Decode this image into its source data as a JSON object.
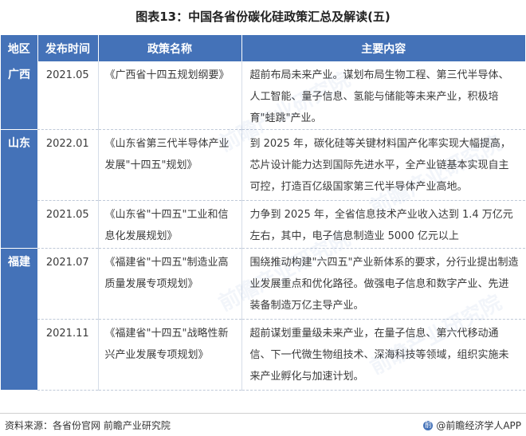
{
  "title": "图表13：中国各省份碳化硅政策汇总及解读(五)",
  "table": {
    "headers": [
      "地区",
      "发布时间",
      "政策名称",
      "主要内容"
    ],
    "regions": [
      {
        "name": "广西",
        "rows": [
          {
            "date": "2021.05",
            "policy": "《广西省十四五规划纲要》",
            "content": "超前布局未来产业。谋划布局生物工程、第三代半导体、人工智能、量子信息、氢能与储能等未来产业，积极培育\"蛙跳\"产业。"
          }
        ]
      },
      {
        "name": "山东",
        "rows": [
          {
            "date": "2022.01",
            "policy": "《山东省第三代半导体产业发展\"十四五\"规划》",
            "content": "到 2025 年，碳化硅等关键材料国产化率实现大幅提高，芯片设计能力达到国际先进水平，全产业链基本实现自主可控，打造百亿级国家第三代半导体产业高地。"
          },
          {
            "date": "2021.05",
            "policy": "《山东省\"十四五\"工业和信息化发展规划》",
            "content": "力争到  2025 年，全省信息技术产业收入达到  1.4  万亿元左右，其中，电子信息制造业 5000 亿元以上"
          }
        ]
      },
      {
        "name": "福建",
        "rows": [
          {
            "date": "2021.07",
            "policy": "《福建省\"十四五\"制造业高质量发展专项规划》",
            "content": "围绕推动构建\"六四五\"产业新体系的要求，分行业提出制造业发展重点和优化路径。做强电子信息和数字产业、先进装备制造万亿主导产业。"
          },
          {
            "date": "2021.11",
            "policy": "《福建省\"十四五\"战略性新兴产业发展专项规划》",
            "content": "超前谋划重量级未来产业，在量子信息、第六代移动通信、下一代微生物组技术、深海科技等领域，组织实施未来产业孵化与加速计划。"
          }
        ]
      }
    ]
  },
  "watermark_text": "前瞻产业研究院",
  "footer": {
    "source": "资料来源：各省份官网 前瞻产业研究院",
    "brand": "@前瞻经济学人APP"
  }
}
